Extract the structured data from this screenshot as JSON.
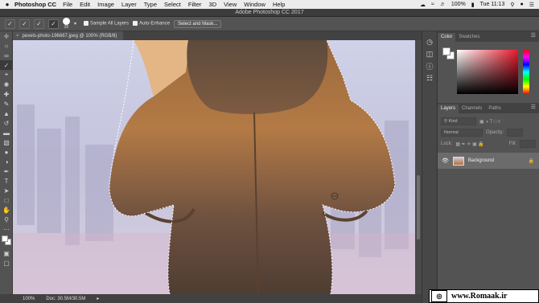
{
  "menubar": {
    "app_name": "Photoshop CC",
    "items": [
      "File",
      "Edit",
      "Image",
      "Layer",
      "Type",
      "Select",
      "Filter",
      "3D",
      "View",
      "Window",
      "Help"
    ],
    "battery": "100%",
    "time": "Tue 11:13"
  },
  "window": {
    "title": "Adobe Photoshop CC 2017"
  },
  "options": {
    "brush_size": "20",
    "sample_all_layers": "Sample All Layers",
    "auto_enhance": "Auto-Enhance",
    "select_mask_button": "Select and Mask..."
  },
  "document": {
    "tab_label": "pexels-photo-196667.jpeg @ 100% (RGB/8)",
    "zoom": "100%",
    "doc_size": "Doc: 30.5M/30.5M"
  },
  "color_panel": {
    "tabs": [
      "Color",
      "Swatches"
    ],
    "hue_color": "#e8192c"
  },
  "layers_panel": {
    "tabs": [
      "Layers",
      "Channels",
      "Paths"
    ],
    "kind_filter": "Kind",
    "blend_mode": "Normal",
    "opacity_label": "Opacity:",
    "lock_label": "Lock:",
    "fill_label": "Fill:",
    "layers": [
      {
        "name": "Background",
        "visible": true,
        "locked": true
      }
    ]
  },
  "watermark": {
    "text": "www.Romaak.ir"
  }
}
